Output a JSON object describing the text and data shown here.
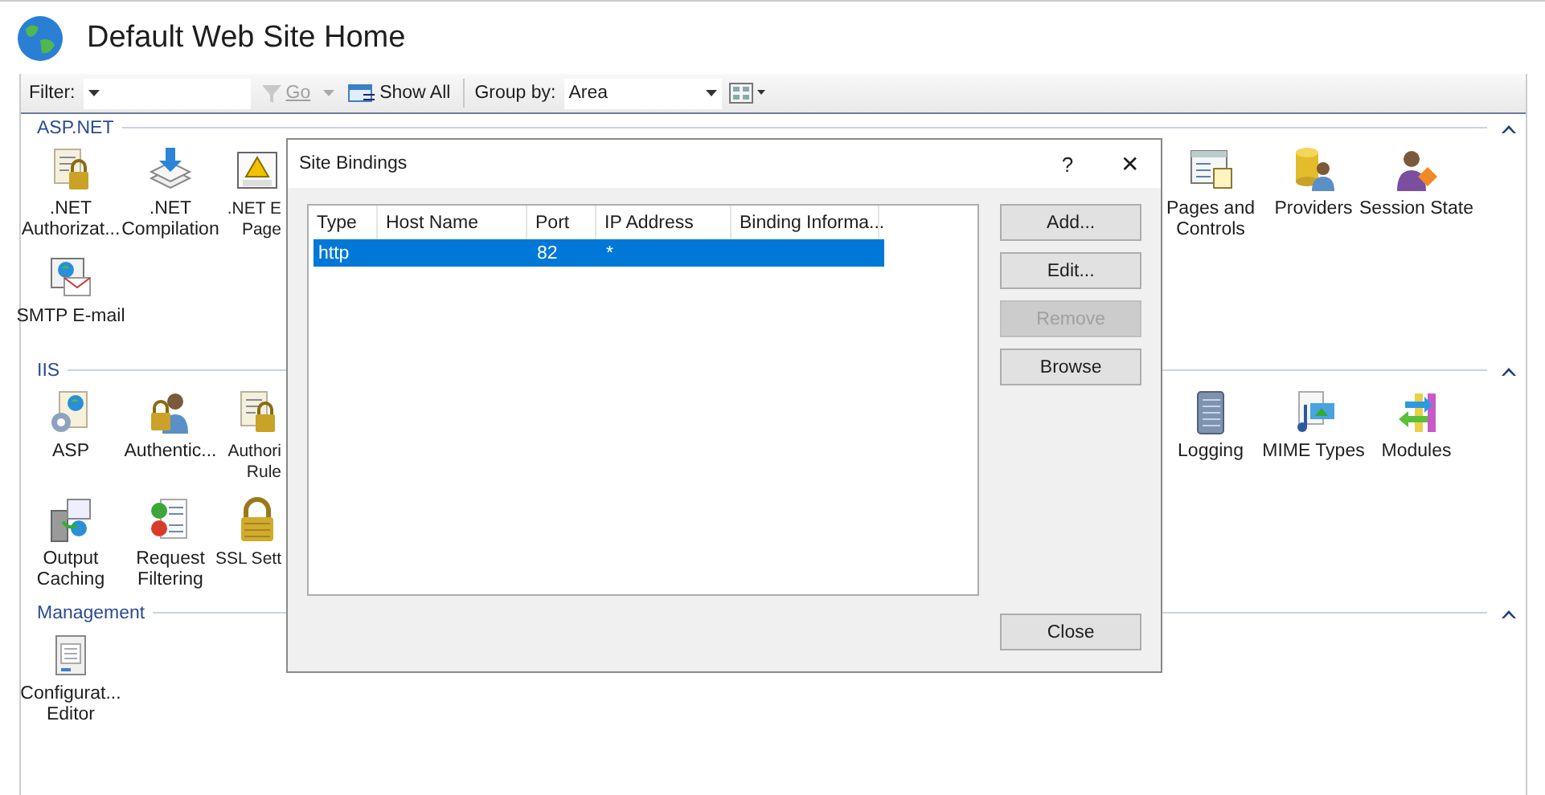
{
  "window": {
    "title": "Default Web Site Home"
  },
  "toolbar": {
    "filter_label": "Filter:",
    "go": {
      "label": "Go",
      "disabled": true
    },
    "show_all": "Show All",
    "group_by_label": "Group by:",
    "group_by_value": "Area"
  },
  "sections": [
    {
      "title": "ASP.NET",
      "expanded": true,
      "left_items": [
        {
          "lines": [
            ".NET",
            "Authorizat..."
          ],
          "partial": false
        },
        {
          "lines": [
            ".NET",
            "Compilation"
          ],
          "partial": false
        },
        {
          "lines": [
            ".NET E",
            "Page"
          ],
          "partial": true
        },
        {
          "lines": [
            "SMTP E-mail"
          ],
          "partial": false
        }
      ],
      "right_items": [
        {
          "lines": [
            "Pages and",
            "Controls"
          ]
        },
        {
          "lines": [
            "Providers"
          ]
        },
        {
          "lines": [
            "Session State"
          ]
        }
      ]
    },
    {
      "title": "IIS",
      "expanded": true,
      "left_items": [
        {
          "lines": [
            "ASP"
          ],
          "partial": false
        },
        {
          "lines": [
            "Authentic..."
          ],
          "partial": false
        },
        {
          "lines": [
            "Authori",
            "Rule"
          ],
          "partial": true
        },
        {
          "lines": [
            "Output",
            "Caching"
          ],
          "partial": false
        },
        {
          "lines": [
            "Request",
            "Filtering"
          ],
          "partial": false
        },
        {
          "lines": [
            "SSL Sett"
          ],
          "partial": true
        }
      ],
      "right_items": [
        {
          "lines": [
            "Logging"
          ]
        },
        {
          "lines": [
            "MIME Types"
          ]
        },
        {
          "lines": [
            "Modules"
          ]
        }
      ]
    },
    {
      "title": "Management",
      "expanded": true,
      "left_items": [
        {
          "lines": [
            "Configurat...",
            "Editor"
          ],
          "partial": false
        }
      ]
    }
  ],
  "dialog": {
    "title": "Site Bindings",
    "help": "?",
    "close_glyph": "✕",
    "columns": [
      "Type",
      "Host Name",
      "Port",
      "IP Address",
      "Binding Informa..."
    ],
    "rows": [
      {
        "cells": [
          "http",
          "",
          "82",
          "*",
          ""
        ],
        "selected": true
      }
    ],
    "buttons": [
      {
        "label": "Add...",
        "disabled": false
      },
      {
        "label": "Edit...",
        "disabled": false
      },
      {
        "label": "Remove",
        "disabled": true
      },
      {
        "label": "Browse",
        "disabled": false
      }
    ],
    "close_button": "Close"
  }
}
